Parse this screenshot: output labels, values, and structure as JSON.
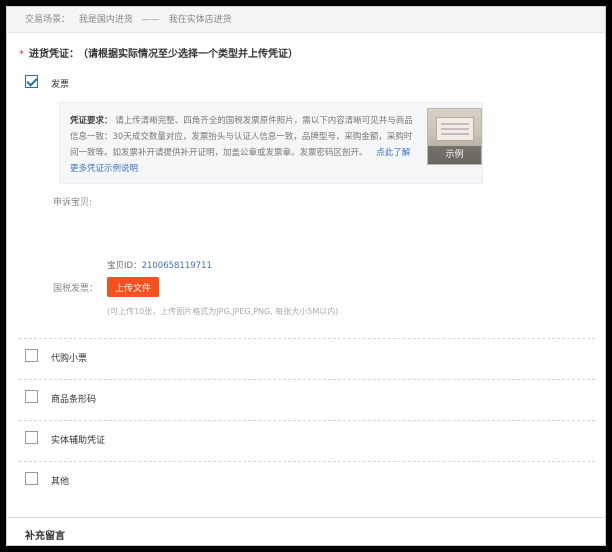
{
  "scene": {
    "label": "交易场景：",
    "value": "我是国内进货",
    "separator": "——",
    "subvalue": "我在实体店进货"
  },
  "section": {
    "required_mark": "*",
    "title": "进货凭证：",
    "hint": "（请根据实际情况至少选择一个类型并上传凭证）"
  },
  "invoice": {
    "label": "发票",
    "checked": true,
    "requirement_label": "凭证要求：",
    "requirement_text": "请上传清晰完整、四角齐全的国税发票原件照片，需以下内容清晰可见并与商品信息一致：30天成交数量对应，发票抬头与认证人信息一致，品牌型号，采购金额，采购时间一致等。如发票补开请提供补开证明，加盖公章或发票章。发票密码区剖开。",
    "example_link": "点此了解更多凭证示例说明",
    "example_tag": "示例"
  },
  "appeal": {
    "label": "申诉宝贝:",
    "item_id_label": "宝贝ID：",
    "item_id": "2100658119711",
    "tax_invoice_label": "国税发票：",
    "upload_button": "上传文件",
    "upload_hint": "(可上传10张，上传图片格式为JPG,JPEG,PNG, 每张大小5M以内)"
  },
  "options": [
    {
      "label": "代购小票",
      "checked": false
    },
    {
      "label": "商品条形码",
      "checked": false
    },
    {
      "label": "实体辅助凭证",
      "checked": false
    },
    {
      "label": "其他",
      "checked": false
    }
  ],
  "supplement": {
    "title": "补充留言"
  },
  "colors": {
    "accent": "#f4511e",
    "link": "#3b73c8",
    "required": "#e4393c"
  }
}
